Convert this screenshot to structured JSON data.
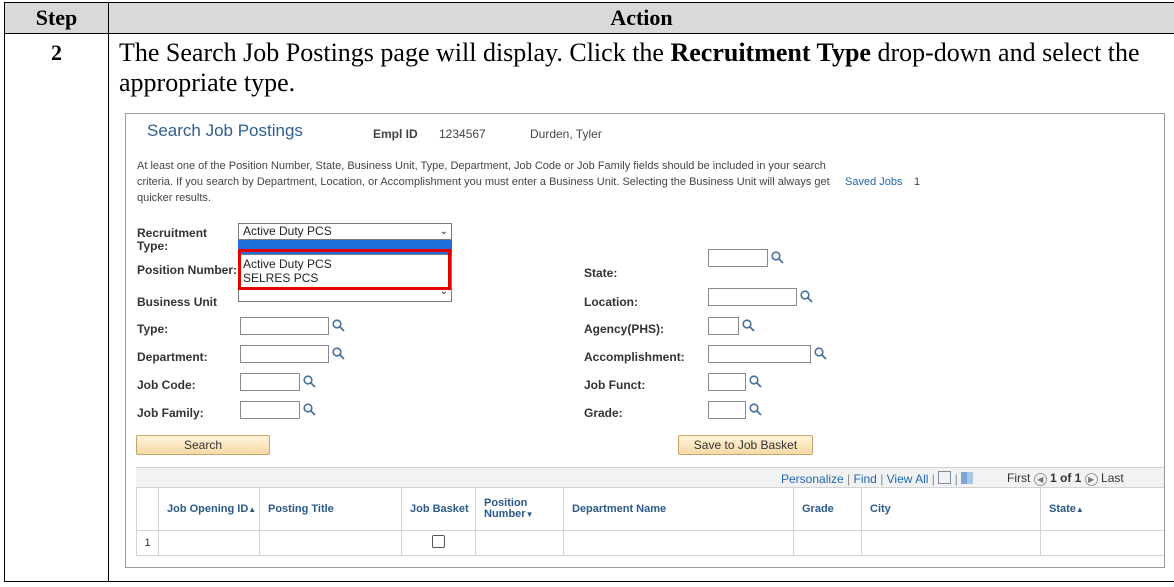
{
  "doc": {
    "col_step": "Step",
    "col_action": "Action",
    "step_number": "2",
    "instr_part1": "The Search Job Postings page will display. Click the ",
    "instr_bold": "Recruitment Type",
    "instr_part2": " drop-down and select the appropriate type."
  },
  "ps": {
    "title": "Search Job Postings",
    "empl_label": "Empl ID",
    "empl_id": "1234567",
    "name": "Durden, Tyler",
    "note": "At least one of the Position Number, State, Business Unit, Type, Department, Job Code or Job Family fields should be included in your search criteria. If you search by Department, Location, or Accomplishment you must enter a Business Unit. Selecting the Business Unit will always get quicker results.",
    "saved_jobs": "Saved Jobs",
    "saved_jobs_count": "1",
    "recruitment_label_1": "Recruitment",
    "recruitment_label_2": "Type:",
    "recruitment_value": "Active Duty PCS",
    "dropdown_options": [
      "Active Duty PCS",
      "SELRES PCS"
    ],
    "labels_left": {
      "position_number": "Position Number:",
      "business_unit": "Business Unit",
      "type": "Type:",
      "department": "Department:",
      "job_code": "Job Code:",
      "job_family": "Job Family:"
    },
    "labels_right": {
      "state": "State:",
      "location": "Location:",
      "agency": "Agency(PHS):",
      "accomplishment": "Accomplishment:",
      "job_funct": "Job Funct:",
      "grade": "Grade:"
    },
    "search_button": "Search",
    "save_basket_button": "Save to Job Basket",
    "grid_nav": {
      "personalize": "Personalize",
      "find": "Find",
      "view_all": "View All",
      "first": "First",
      "range": "1 of 1",
      "last": "Last"
    },
    "columns": [
      "",
      "Job Opening ID",
      "Posting Title",
      "Job Basket",
      "Position Number",
      "Department Name",
      "Grade",
      "City",
      "State"
    ],
    "row_number": "1"
  },
  "colors": {
    "highlight": "#e00000",
    "title_blue": "#2f5f8f",
    "link_blue": "#1f66b4",
    "button_fill": "#f6d9a6"
  }
}
